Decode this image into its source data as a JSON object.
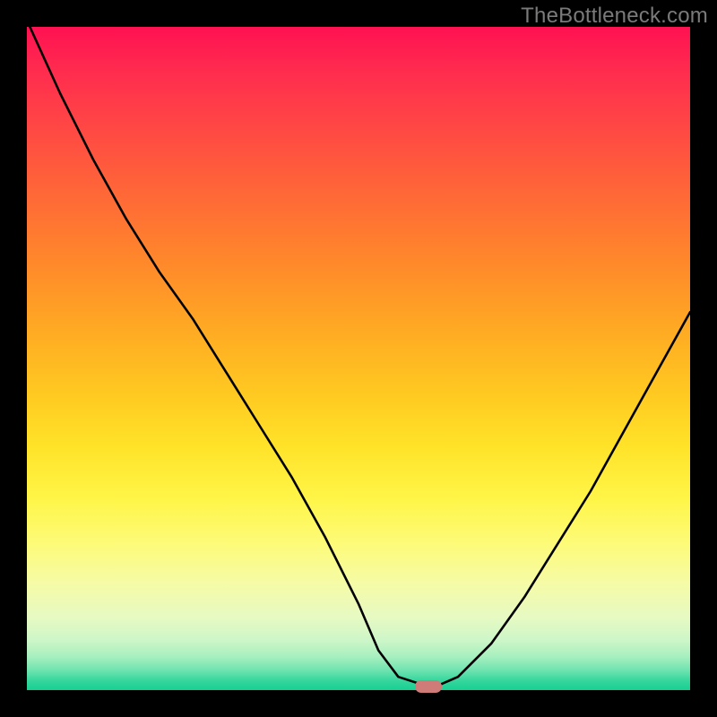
{
  "watermark": "TheBottleneck.com",
  "chart_data": {
    "type": "line",
    "title": "",
    "xlabel": "",
    "ylabel": "",
    "xlim": [
      0,
      100
    ],
    "ylim": [
      0,
      100
    ],
    "grid": false,
    "series": [
      {
        "name": "curve",
        "x": [
          0,
          5,
          10,
          15,
          20,
          25,
          30,
          35,
          40,
          45,
          50,
          53,
          56,
          60,
          62,
          65,
          70,
          75,
          80,
          85,
          90,
          95,
          100
        ],
        "y": [
          101,
          90,
          80,
          71,
          63,
          56,
          48,
          40,
          32,
          23,
          13,
          6,
          2,
          0.7,
          0.7,
          2,
          7,
          14,
          22,
          30,
          39,
          48,
          57
        ]
      }
    ],
    "marker": {
      "x": 60.5,
      "y": 0.5,
      "color": "#cf7b77"
    },
    "background": {
      "type": "vertical-gradient",
      "stops": [
        {
          "pos": 0,
          "color": "#ff1152"
        },
        {
          "pos": 0.5,
          "color": "#ffb522"
        },
        {
          "pos": 0.78,
          "color": "#fdfb79"
        },
        {
          "pos": 1.0,
          "color": "#17d092"
        }
      ]
    }
  }
}
